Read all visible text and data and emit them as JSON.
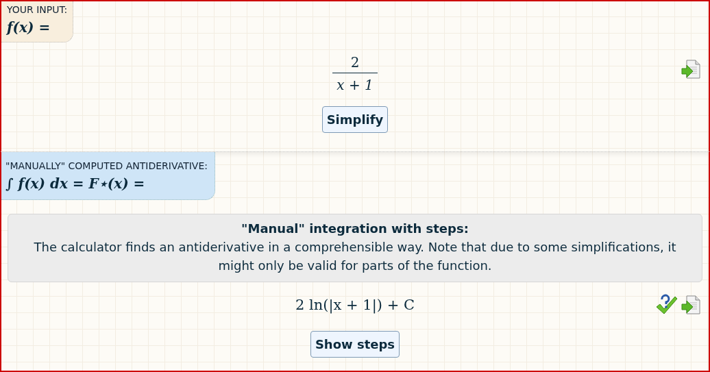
{
  "input_section": {
    "label": "YOUR INPUT:",
    "formula": "f(x) =",
    "expression": {
      "numerator": "2",
      "denominator": "x + 1"
    },
    "button": "Simplify"
  },
  "antiderivative_section": {
    "label": "\"MANUALLY\" COMPUTED ANTIDERIVATIVE:",
    "formula": "∫ f(x) dx = F⋆(x) =",
    "info": {
      "title": "\"Manual\" integration with steps:",
      "text": "The calculator finds an antiderivative in a comprehensible way. Note that due to some simplifications, it might only be valid for parts of the function."
    },
    "result": "2 ln(|x + 1|) + C",
    "button": "Show steps"
  }
}
